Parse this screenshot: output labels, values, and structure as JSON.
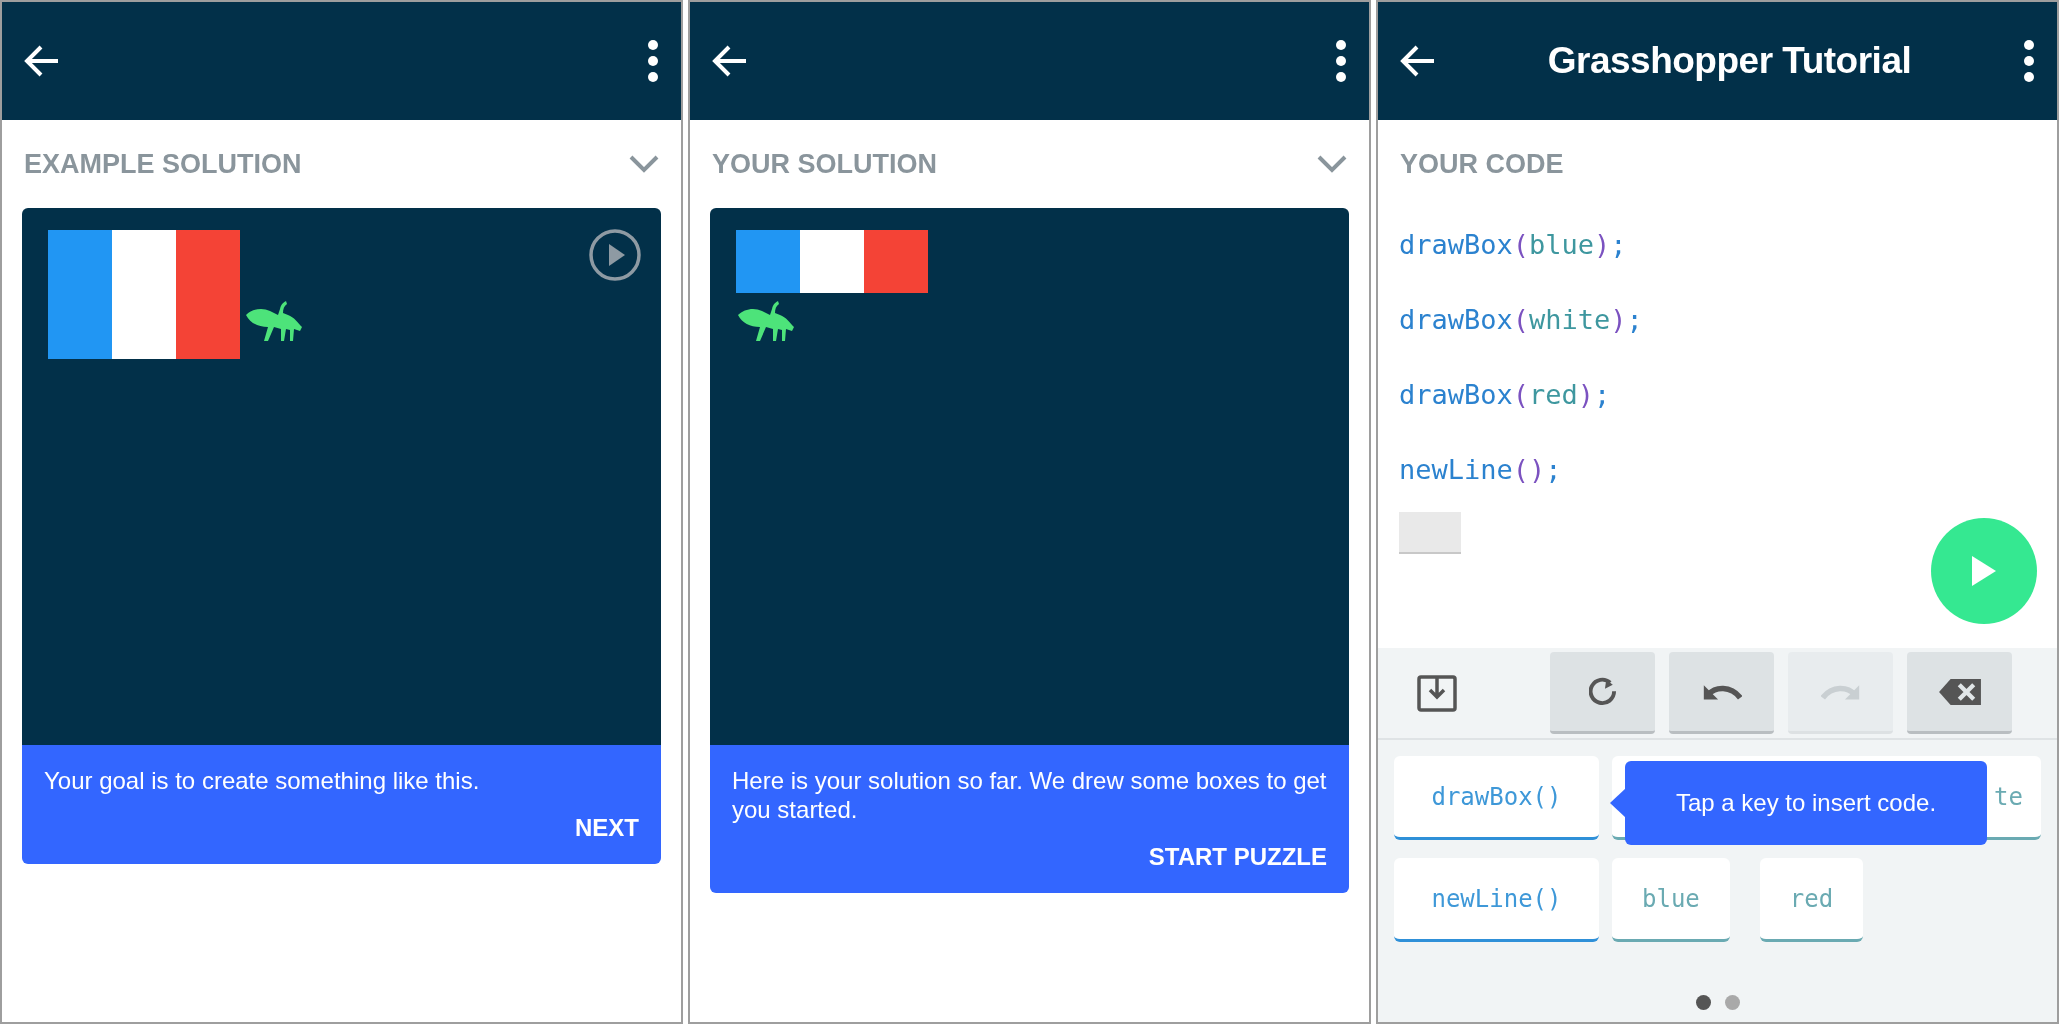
{
  "panels": [
    {
      "kind": "preview",
      "section_title": "EXAMPLE SOLUTION",
      "canvas": {
        "kind": "tall",
        "show_play": true,
        "boxes": [
          {
            "color": "#2196f3"
          },
          {
            "color": "#ffffff"
          },
          {
            "color": "#f44336"
          }
        ]
      },
      "message": "Your goal is to create something like this.",
      "action": "NEXT"
    },
    {
      "kind": "preview",
      "section_title": "YOUR SOLUTION",
      "canvas": {
        "kind": "short",
        "show_play": false,
        "boxes": [
          {
            "color": "#2196f3"
          },
          {
            "color": "#ffffff"
          },
          {
            "color": "#f44336"
          }
        ]
      },
      "message": "Here is your solution so far. We drew some boxes to get you started.",
      "action": "START PUZZLE"
    },
    {
      "kind": "editor",
      "header": {
        "title": "Grasshopper Tutorial"
      },
      "section_title": "YOUR CODE",
      "code": [
        [
          {
            "kind": "fn",
            "text": "drawBox"
          },
          {
            "kind": "paren",
            "text": "("
          },
          {
            "kind": "arg",
            "text": "blue"
          },
          {
            "kind": "paren",
            "text": ")"
          },
          {
            "kind": "punct",
            "text": ";"
          }
        ],
        [
          {
            "kind": "fn",
            "text": "drawBox"
          },
          {
            "kind": "paren",
            "text": "("
          },
          {
            "kind": "arg",
            "text": "white"
          },
          {
            "kind": "paren",
            "text": ")"
          },
          {
            "kind": "punct",
            "text": ";"
          }
        ],
        [
          {
            "kind": "fn",
            "text": "drawBox"
          },
          {
            "kind": "paren",
            "text": "("
          },
          {
            "kind": "arg",
            "text": "red"
          },
          {
            "kind": "paren",
            "text": ")"
          },
          {
            "kind": "punct",
            "text": ";"
          }
        ],
        [
          {
            "kind": "fn",
            "text": "newLine"
          },
          {
            "kind": "paren",
            "text": "()"
          },
          {
            "kind": "punct",
            "text": ";"
          }
        ]
      ],
      "toolbar": [
        {
          "kind": "import",
          "disabled": false
        },
        {
          "kind": "reset",
          "disabled": false
        },
        {
          "kind": "undo",
          "disabled": false
        },
        {
          "kind": "redo",
          "disabled": true
        },
        {
          "kind": "delete",
          "disabled": false
        }
      ],
      "keys": [
        [
          {
            "kind": "function",
            "text": "drawBox()"
          },
          {
            "kind": "value",
            "text": "te"
          }
        ],
        [
          {
            "kind": "function",
            "text": "newLine()"
          },
          {
            "kind": "value",
            "text": "blue"
          },
          {
            "kind": "value",
            "text": "red"
          }
        ]
      ],
      "tooltip": "Tap a key to insert code.",
      "pages": [
        {
          "selected": true
        },
        {
          "selected": false
        }
      ]
    }
  ]
}
